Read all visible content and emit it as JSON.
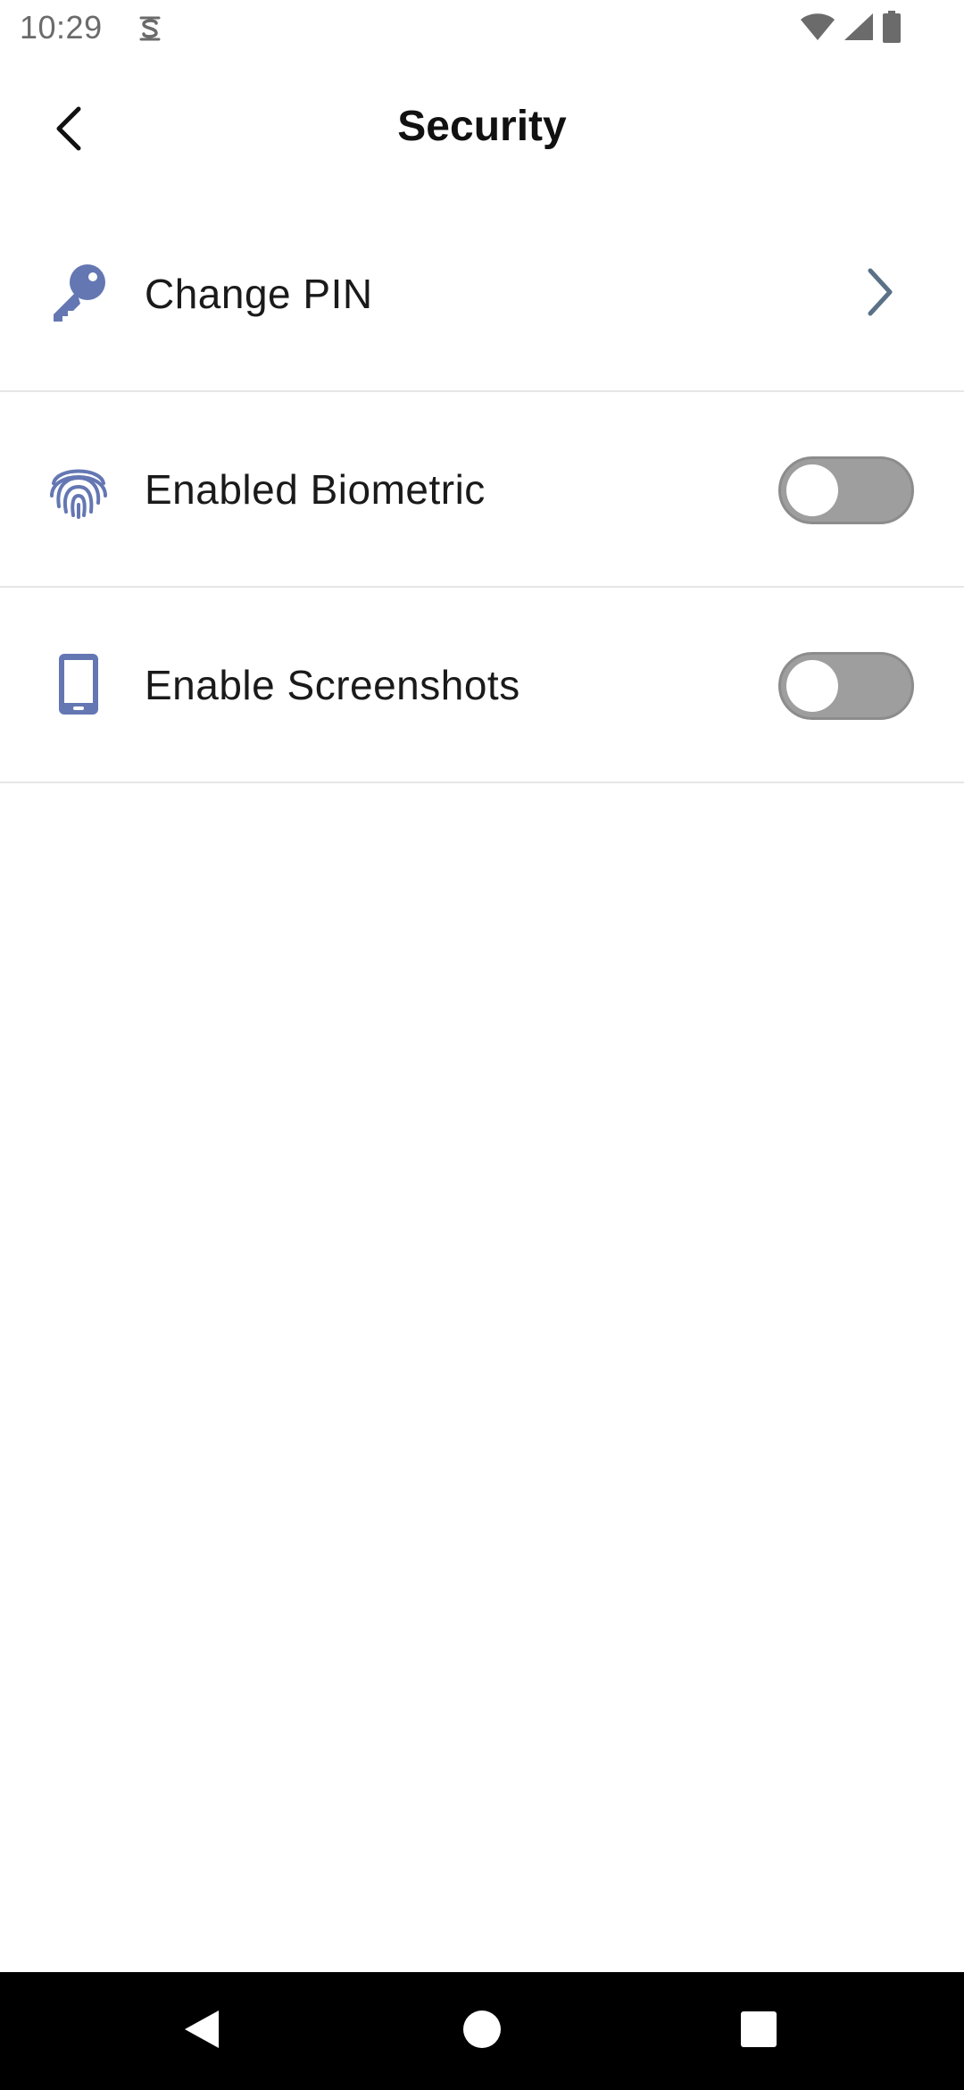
{
  "status_bar": {
    "time": "10:29",
    "app_icon": "s-notification-icon",
    "icons": [
      "wifi-icon",
      "signal-icon",
      "battery-icon"
    ]
  },
  "header": {
    "title": "Security",
    "back_icon": "chevron-left-icon"
  },
  "settings": [
    {
      "label": "Change PIN",
      "icon": "key-icon",
      "control": "chevron",
      "control_icon": "chevron-right-icon"
    },
    {
      "label": "Enabled Biometric",
      "icon": "fingerprint-icon",
      "control": "toggle",
      "enabled": false
    },
    {
      "label": "Enable Screenshots",
      "icon": "phone-icon",
      "control": "toggle",
      "enabled": false
    }
  ],
  "nav_bar": {
    "buttons": [
      "back-triangle-icon",
      "home-circle-icon",
      "recents-square-icon"
    ]
  },
  "colors": {
    "accent": "#6477b3",
    "chevron": "#5a7187",
    "toggle_off": "#9e9e9e",
    "divider": "#e6e6e6"
  }
}
